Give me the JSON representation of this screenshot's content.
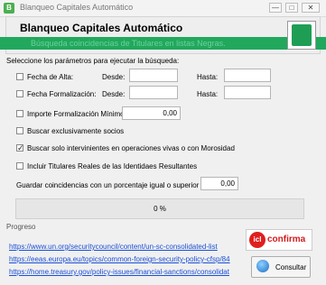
{
  "window": {
    "title": "Blanqueo Capitales Automático",
    "icon_letter": "B",
    "minimize": "—",
    "maximize": "□",
    "close": "✕"
  },
  "header": {
    "title": "Blanqueo Capitales Automático",
    "subtitle": "Búsqueda coincidencias de Titulares en listas Negras."
  },
  "form": {
    "instruction": "Seleccione los parámetros para ejecutar la búsqueda:",
    "fecha_alta": {
      "label": "Fecha de Alta:",
      "checked": false,
      "desde_label": "Desde:",
      "hasta_label": "Hasta:",
      "desde_value": "",
      "hasta_value": ""
    },
    "fecha_formalizacion": {
      "label": "Fecha Formalización:",
      "checked": false,
      "desde_label": "Desde:",
      "hasta_label": "Hasta:",
      "desde_value": "",
      "hasta_value": ""
    },
    "importe_minimo": {
      "label": "Importe Formalización Mínimo:",
      "checked": false,
      "value": "0,00"
    },
    "socios": {
      "label": "Buscar exclusivamente socios",
      "checked": false
    },
    "vivas": {
      "label": "Buscar solo intervinientes en operaciones vivas o con Morosidad",
      "checked": true,
      "check_glyph": "✓"
    },
    "titulares_reales": {
      "label": "Incluir Titulares Reales de las Identidaes Resultantes",
      "checked": false
    },
    "porcentaje": {
      "label": "Guardar coincidencias con un porcentaje igual o superior a:",
      "value": "0,00"
    }
  },
  "progress": {
    "value_text": "0 %",
    "percent": 0,
    "label": "Progreso"
  },
  "links": [
    "https://www.un.org/securitycouncil/content/un-sc-consolidated-list",
    "https://eeas.europa.eu/topics/common-foreign-security-policy-cfsp/84",
    "https://home.treasury.gov/policy-issues/financial-sanctions/consolidat"
  ],
  "brand": {
    "icl_mark": "icl",
    "icl_word": "confirma"
  },
  "actions": {
    "consultar": "Consultar"
  },
  "colors": {
    "banner_green": "#21a85d",
    "link_blue": "#1a4fd6",
    "brand_red": "#d21c1c"
  }
}
